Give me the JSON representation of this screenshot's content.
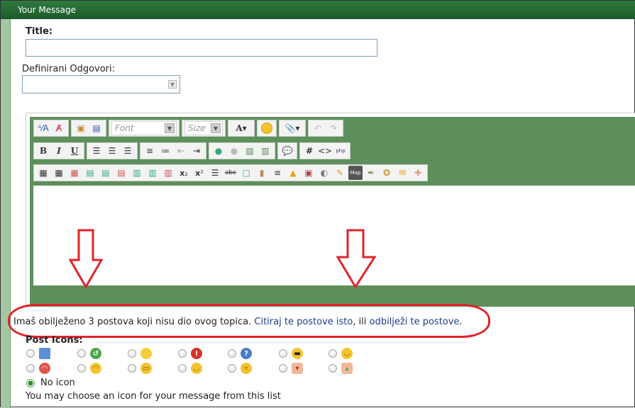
{
  "header": {
    "title": "Your Message"
  },
  "form": {
    "title_label": "Title:",
    "title_value": "",
    "predefined_label": "Definirani Odgovori:",
    "predefined_value": ""
  },
  "toolbar": {
    "font_placeholder": "Font",
    "size_placeholder": "Size"
  },
  "notice": {
    "prefix": "Imaš obilježeno 3 postova koji nisu dio ovog topica.",
    "link_quote": "Citiraj te postove isto",
    "middle": ", ili",
    "link_unmark": "odbilježi te postove",
    "suffix": "."
  },
  "post_icons": {
    "label": "Post Icons:",
    "row1": [
      "document",
      "green-arrow",
      "lightbulb",
      "exclamation",
      "question",
      "cool",
      "smile"
    ],
    "row2": [
      "angry",
      "frown",
      "grin",
      "happy",
      "laugh",
      "thumbs-down",
      "thumbs-up"
    ],
    "no_icon_label": "No icon",
    "hint": "You may choose an icon for your message from this list"
  }
}
